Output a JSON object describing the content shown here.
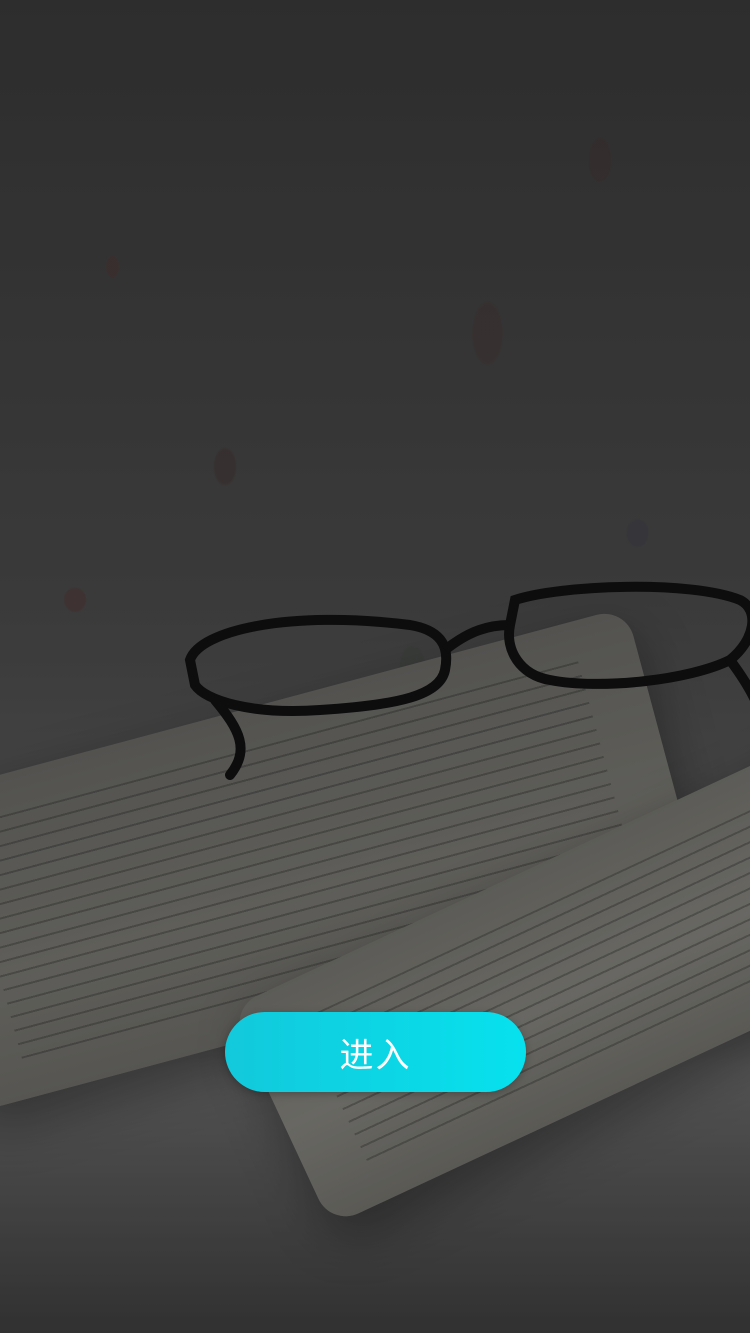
{
  "background": {
    "icon": "photo-book-glasses"
  },
  "button": {
    "label": "进入",
    "color_start": "#12c9db",
    "color_end": "#07e1ee"
  }
}
